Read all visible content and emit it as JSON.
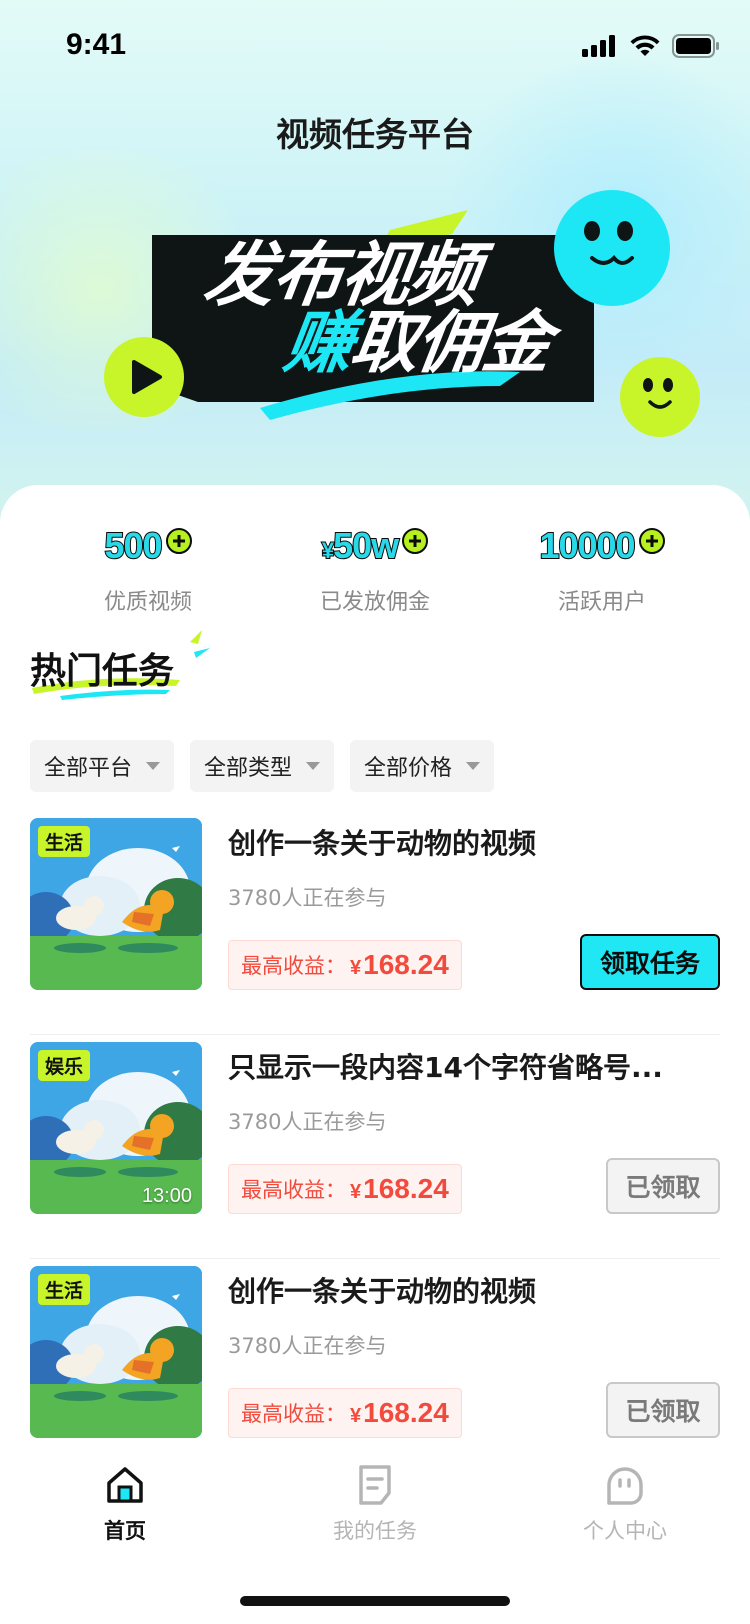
{
  "status_bar": {
    "time": "9:41"
  },
  "app": {
    "title": "视频任务平台"
  },
  "banner": {
    "line1": "发布视频",
    "line2_accent": "赚",
    "line2_rest": "取佣金"
  },
  "stats": [
    {
      "value": "500",
      "prefix": "",
      "label": "优质视频"
    },
    {
      "value": "50w",
      "prefix": "¥",
      "label": "已发放佣金"
    },
    {
      "value": "10000",
      "prefix": "",
      "label": "活跃用户"
    }
  ],
  "section": {
    "title": "热门任务"
  },
  "filters": [
    {
      "label": "全部平台"
    },
    {
      "label": "全部类型"
    },
    {
      "label": "全部价格"
    }
  ],
  "tasks": [
    {
      "tag": "生活",
      "duration": "",
      "title": "创作一条关于动物的视频",
      "participants": "3780人正在参与",
      "earn_label": "最高收益：",
      "currency": "¥",
      "amount": "168.24",
      "button": "领取任务",
      "claimed": false
    },
    {
      "tag": "娱乐",
      "duration": "13:00",
      "title": "只显示一段内容14个字符省略号...",
      "participants": "3780人正在参与",
      "earn_label": "最高收益：",
      "currency": "¥",
      "amount": "168.24",
      "button": "已领取",
      "claimed": true
    },
    {
      "tag": "生活",
      "duration": "",
      "title": "创作一条关于动物的视频",
      "participants": "3780人正在参与",
      "earn_label": "最高收益：",
      "currency": "¥",
      "amount": "168.24",
      "button": "已领取",
      "claimed": true
    }
  ],
  "tabbar": [
    {
      "label": "首页",
      "icon": "home-icon",
      "active": true
    },
    {
      "label": "我的任务",
      "icon": "task-doc-icon",
      "active": false
    },
    {
      "label": "个人中心",
      "icon": "profile-face-icon",
      "active": false
    }
  ],
  "colors": {
    "accent_cyan": "#1fe8f4",
    "accent_lime": "#b6f01e",
    "price_red": "#f24a3d"
  }
}
